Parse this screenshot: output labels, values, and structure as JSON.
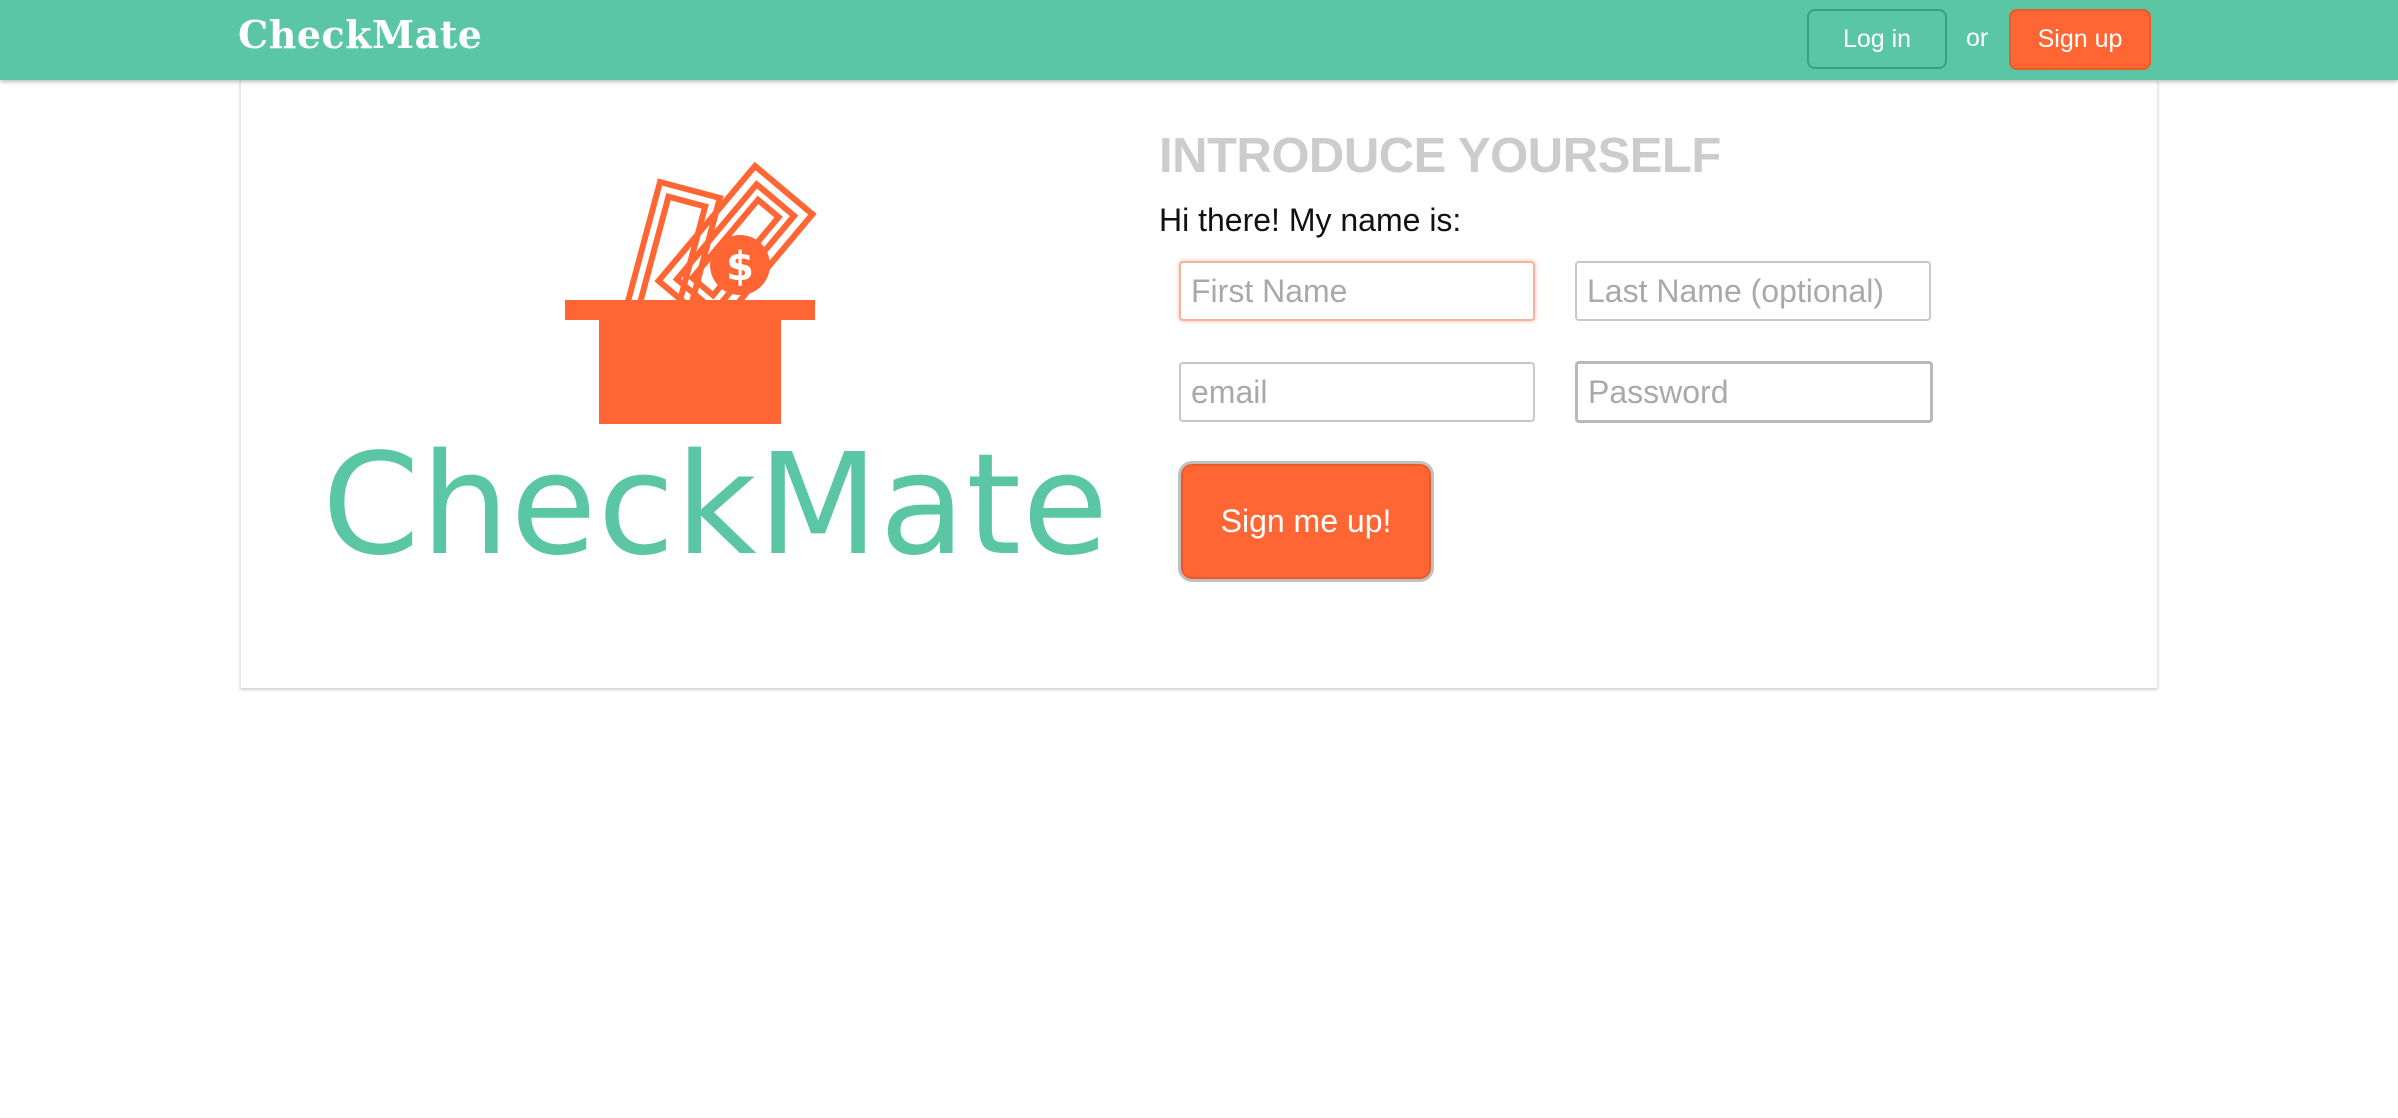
{
  "header": {
    "brand": "CheckMate",
    "login_label": "Log in",
    "or_text": "or",
    "signup_label": "Sign up"
  },
  "logo": {
    "text": "CheckMate",
    "icon": "money-box-icon"
  },
  "form": {
    "heading": "INTRODUCE YOURSELF",
    "intro": "Hi there! My name is:",
    "first_name_placeholder": "First Name",
    "last_name_placeholder": "Last Name (optional)",
    "email_placeholder": "email",
    "password_placeholder": "Password",
    "submit_label": "Sign me up!"
  },
  "colors": {
    "brand_green": "#5bc6a4",
    "accent_orange": "#ff6633",
    "heading_gray": "#cccccc"
  }
}
